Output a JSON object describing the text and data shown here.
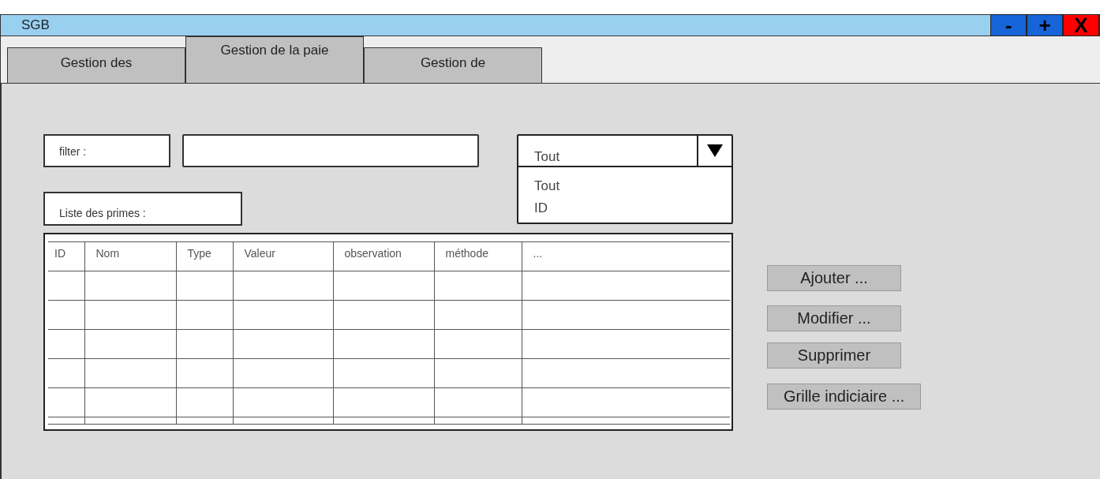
{
  "window": {
    "title": "SGB",
    "controls": [
      {
        "label": "-",
        "kind": "minimize"
      },
      {
        "label": "+",
        "kind": "maximize"
      },
      {
        "label": "X",
        "kind": "close"
      }
    ]
  },
  "tabs": [
    {
      "label": "Gestion des",
      "selected": false
    },
    {
      "label": "Gestion de la paie",
      "selected": true
    },
    {
      "label": "Gestion de",
      "selected": false
    }
  ],
  "filter": {
    "label": "filter :"
  },
  "dropdown": {
    "value": "Tout",
    "expanded": true,
    "options": [
      "Tout",
      "ID"
    ]
  },
  "list_label": "Liste des primes :",
  "table": {
    "columns": [
      "ID",
      "Nom",
      "Type",
      "Valeur",
      "observation",
      "méthode",
      "..."
    ]
  },
  "buttons": [
    "Ajouter ...",
    "Modifier ...",
    "Supprimer",
    "Grille indiciaire ..."
  ]
}
